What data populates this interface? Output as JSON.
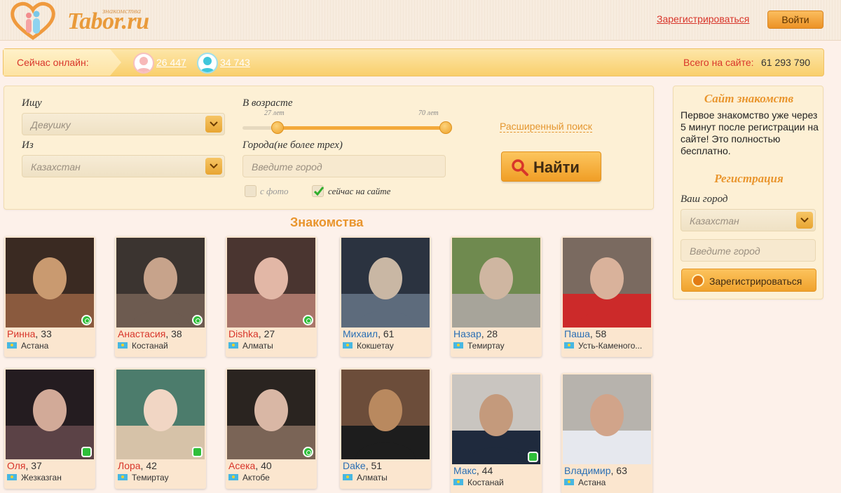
{
  "header": {
    "logo_small": "знакомства",
    "logo_text": "Tabor.ru",
    "register_link": "Зарегистрироваться",
    "login_button": "Войти"
  },
  "online": {
    "label": "Сейчас онлайн:",
    "women_count": "26 447",
    "men_count": "34 743",
    "total_label": "Всего на сайте:",
    "total_value": "61 293 790"
  },
  "search": {
    "seeking_label": "Ищу",
    "seeking_value": "Девушку",
    "from_label": "Из",
    "from_value": "Казахстан",
    "age_label": "В возрасте",
    "age_min_label": "27 лет",
    "age_max_label": "70 лет",
    "age_min": 27,
    "age_max": 70,
    "cities_label": "Города(не более трех)",
    "cities_placeholder": "Введите город",
    "with_photo_label": "с фото",
    "with_photo_checked": false,
    "online_now_label": "сейчас на сайте",
    "online_now_checked": true,
    "advanced_link": "Расширенный поиск",
    "find_button": "Найти"
  },
  "section_title": "Знакомства",
  "profiles": [
    {
      "name": "Ринна",
      "age": ", 33",
      "city": "Астана",
      "gender": "f",
      "status": "online"
    },
    {
      "name": "Анастасия",
      "age": ", 38",
      "city": "Костанай",
      "gender": "f",
      "status": "online"
    },
    {
      "name": "Dishka",
      "age": ", 27",
      "city": "Алматы",
      "gender": "f",
      "status": "online"
    },
    {
      "name": "Михаил",
      "age": ", 61",
      "city": "Кокшетау",
      "gender": "m",
      "status": ""
    },
    {
      "name": "Назар",
      "age": ", 28",
      "city": "Темиртау",
      "gender": "m",
      "status": ""
    },
    {
      "name": "Паша",
      "age": ", 58",
      "city": "Усть-Каменого...",
      "gender": "m",
      "status": ""
    },
    {
      "name": "Оля",
      "age": ", 37",
      "city": "Жезказган",
      "gender": "f",
      "status": "mobile"
    },
    {
      "name": "Лора",
      "age": ", 42",
      "city": "Темиртау",
      "gender": "f",
      "status": "mobile"
    },
    {
      "name": "Асека",
      "age": ", 40",
      "city": "Актобе",
      "gender": "f",
      "status": "online"
    },
    {
      "name": "Dake",
      "age": ", 51",
      "city": "Алматы",
      "gender": "m",
      "status": ""
    },
    {
      "name": "Макс",
      "age": ", 44",
      "city": "Костанай",
      "gender": "m",
      "status": "mobile"
    },
    {
      "name": "Владимир",
      "age": ", 63",
      "city": "Астана",
      "gender": "m",
      "status": ""
    }
  ],
  "sidebar": {
    "title": "Сайт знакомств",
    "text": "Первое знакомство уже через 5 минут после регистрации на сайте! Это полностью бесплатно.",
    "reg_title": "Регистрация",
    "city_label": "Ваш город",
    "country_value": "Казахстан",
    "city_placeholder": "Введите город",
    "register_button": "Зарегистрироваться"
  },
  "colors": {
    "accent": "#e9952d",
    "female_name": "#d8352a",
    "male_name": "#2a6fb4",
    "online": "#2fbf3a"
  }
}
